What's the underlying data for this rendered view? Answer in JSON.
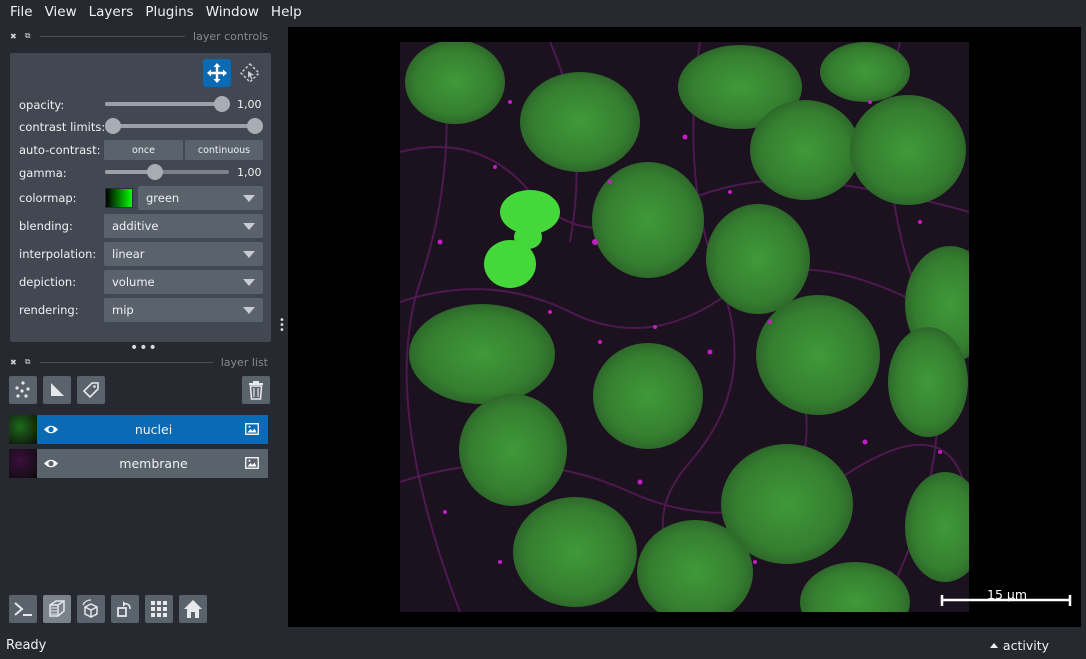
{
  "menu": [
    "File",
    "View",
    "Layers",
    "Plugins",
    "Window",
    "Help"
  ],
  "layer_controls": {
    "title": "layer controls",
    "opacity": {
      "label": "opacity:",
      "value": "1,00",
      "level": 1.0
    },
    "contrast_limits": {
      "label": "contrast limits:",
      "range": [
        0.0,
        1.0
      ]
    },
    "auto_contrast": {
      "label": "auto-contrast:",
      "once": "once",
      "continuous": "continuous"
    },
    "gamma": {
      "label": "gamma:",
      "value": "1,00",
      "level": 0.4
    },
    "colormap": {
      "label": "colormap:",
      "value": "green",
      "color": "#00ff00"
    },
    "blending": {
      "label": "blending:",
      "value": "additive"
    },
    "interpolation": {
      "label": "interpolation:",
      "value": "linear"
    },
    "depiction": {
      "label": "depiction:",
      "value": "volume"
    },
    "rendering": {
      "label": "rendering:",
      "value": "mip"
    }
  },
  "layer_list": {
    "title": "layer list",
    "layers": [
      {
        "name": "nuclei",
        "selected": true,
        "visible": true,
        "thumb_color": "#1f6a1a"
      },
      {
        "name": "membrane",
        "selected": false,
        "visible": true,
        "thumb_color": "#3a0f3c"
      }
    ]
  },
  "scale_bar": {
    "label": "15 µm"
  },
  "status": {
    "text": "Ready",
    "activity": "activity"
  },
  "colors": {
    "accent": "#0a6ab4",
    "panel": "#414851",
    "background": "#262930",
    "nuclei": "#3fbf35",
    "membrane": "#b01ab0"
  }
}
